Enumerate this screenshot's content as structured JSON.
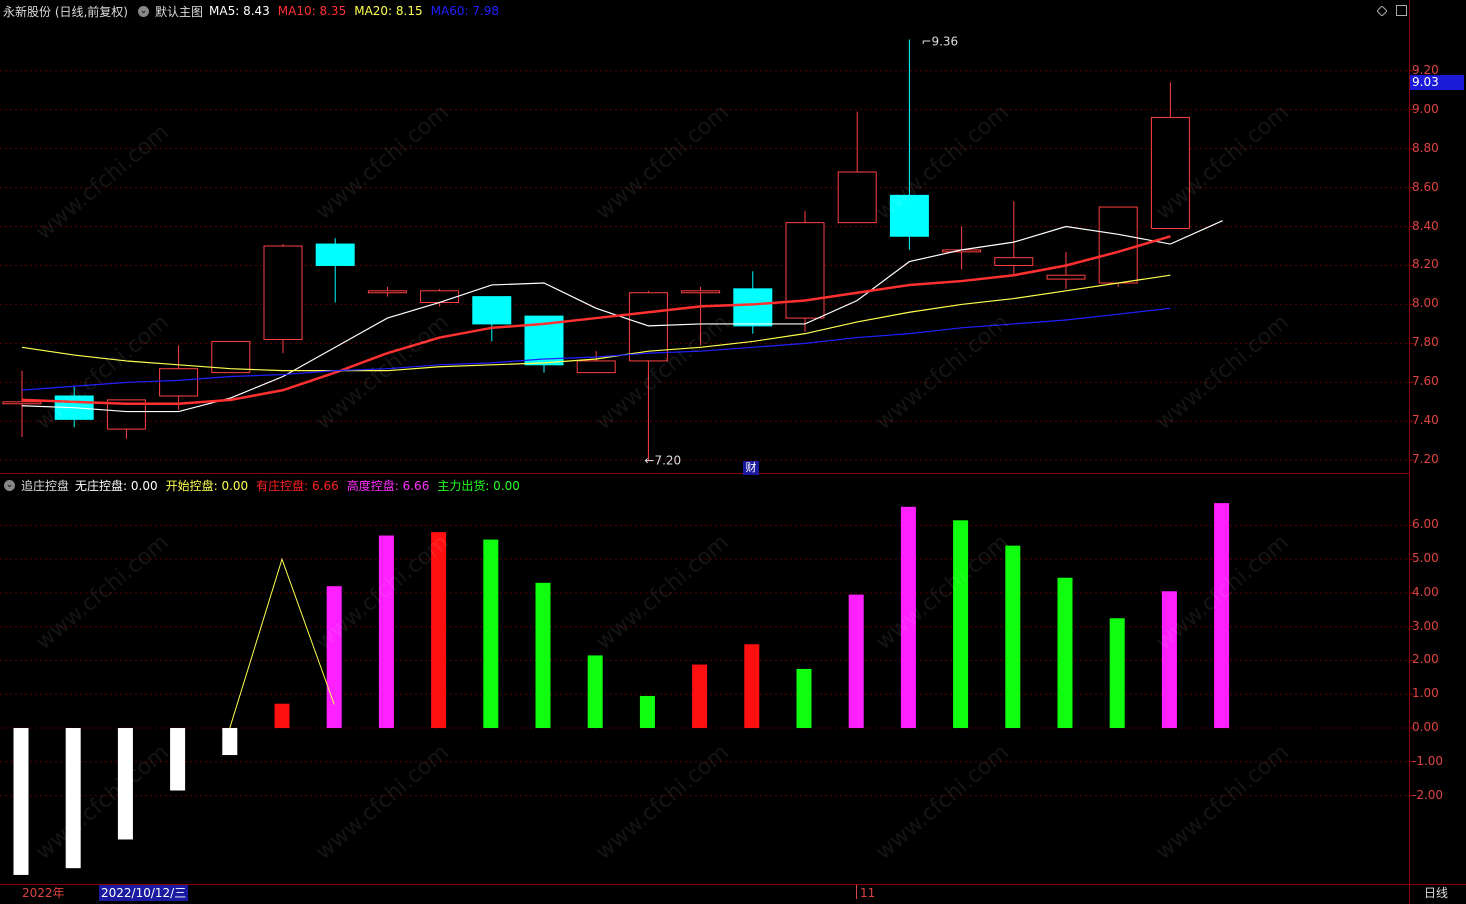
{
  "header": {
    "stock_title": "永新股份 (日线,前复权)",
    "template_label": "默认主图",
    "ma": [
      {
        "label": "MA5:",
        "value": "8.43",
        "color": "#ffffff"
      },
      {
        "label": "MA10:",
        "value": "8.35",
        "color": "#ff3030"
      },
      {
        "label": "MA20:",
        "value": "8.15",
        "color": "#ffff50"
      },
      {
        "label": "MA60:",
        "value": "7.98",
        "color": "#2020ff"
      }
    ]
  },
  "indicator_header": {
    "name": "追庄控盘",
    "items": [
      {
        "label": "无庄控盘:",
        "value": "0.00",
        "color": "#ffffff"
      },
      {
        "label": "开始控盘:",
        "value": "0.00",
        "color": "#ffff50"
      },
      {
        "label": "有庄控盘:",
        "value": "6.66",
        "color": "#ff2020"
      },
      {
        "label": "高度控盘:",
        "value": "6.66",
        "color": "#ff30ff"
      },
      {
        "label": "主力出货:",
        "value": "0.00",
        "color": "#20ff20"
      }
    ]
  },
  "price_axis": [
    "9.20",
    "9.00",
    "8.80",
    "8.60",
    "8.40",
    "8.20",
    "8.00",
    "7.80",
    "7.60",
    "7.40",
    "7.20"
  ],
  "ind_axis": [
    "6.00",
    "5.00",
    "4.00",
    "3.00",
    "2.00",
    "1.00",
    "0.00",
    "-1.00",
    "-2.00"
  ],
  "last_price": "9.03",
  "high_marker": "9.36",
  "low_marker": "7.20",
  "fin_tag": "财",
  "bottom": {
    "year": "2022年",
    "cursor_date": "2022/10/12/三",
    "month_tick": "11",
    "period": "日线"
  },
  "watermark": "www.cfchi.com",
  "chart_data": [
    {
      "type": "candlestick",
      "ylim": [
        7.15,
        9.45
      ],
      "candles": [
        {
          "o": 7.49,
          "h": 7.66,
          "l": 7.32,
          "c": 7.5
        },
        {
          "o": 7.53,
          "h": 7.58,
          "l": 7.37,
          "c": 7.41
        },
        {
          "o": 7.36,
          "h": 7.51,
          "l": 7.31,
          "c": 7.51
        },
        {
          "o": 7.53,
          "h": 7.79,
          "l": 7.46,
          "c": 7.67
        },
        {
          "o": 7.65,
          "h": 7.81,
          "l": 7.65,
          "c": 7.81
        },
        {
          "o": 7.82,
          "h": 8.31,
          "l": 7.75,
          "c": 8.3
        },
        {
          "o": 8.31,
          "h": 8.34,
          "l": 8.01,
          "c": 8.2
        },
        {
          "o": 8.06,
          "h": 8.09,
          "l": 8.04,
          "c": 8.07
        },
        {
          "o": 8.01,
          "h": 8.08,
          "l": 7.99,
          "c": 8.07
        },
        {
          "o": 8.04,
          "h": 8.04,
          "l": 7.81,
          "c": 7.9
        },
        {
          "o": 7.94,
          "h": 7.94,
          "l": 7.65,
          "c": 7.69
        },
        {
          "o": 7.65,
          "h": 7.76,
          "l": 7.65,
          "c": 7.71
        },
        {
          "o": 7.71,
          "h": 8.07,
          "l": 7.2,
          "c": 8.06
        },
        {
          "o": 8.06,
          "h": 8.09,
          "l": 7.79,
          "c": 8.07
        },
        {
          "o": 8.08,
          "h": 8.17,
          "l": 7.85,
          "c": 7.89
        },
        {
          "o": 7.93,
          "h": 8.48,
          "l": 7.86,
          "c": 8.42
        },
        {
          "o": 8.42,
          "h": 8.99,
          "l": 8.42,
          "c": 8.68
        },
        {
          "o": 8.56,
          "h": 9.36,
          "l": 8.28,
          "c": 8.35
        },
        {
          "o": 8.27,
          "h": 8.4,
          "l": 8.18,
          "c": 8.28
        },
        {
          "o": 8.2,
          "h": 8.53,
          "l": 8.15,
          "c": 8.24
        },
        {
          "o": 8.13,
          "h": 8.27,
          "l": 8.08,
          "c": 8.15
        },
        {
          "o": 8.11,
          "h": 8.5,
          "l": 8.09,
          "c": 8.5
        },
        {
          "o": 8.39,
          "h": 9.14,
          "l": 8.39,
          "c": 8.96
        }
      ],
      "ma_series": [
        {
          "name": "MA5",
          "color": "#ffffff",
          "values": [
            7.48,
            7.47,
            7.45,
            7.45,
            7.52,
            7.63,
            7.78,
            7.93,
            8.01,
            8.1,
            8.11,
            7.98,
            7.89,
            7.9,
            7.9,
            7.9,
            8.02,
            8.22,
            8.28,
            8.32,
            8.4,
            8.36,
            8.31,
            8.43
          ]
        },
        {
          "name": "MA10",
          "color": "#ff3030",
          "values": [
            7.51,
            7.5,
            7.49,
            7.49,
            7.51,
            7.56,
            7.65,
            7.75,
            7.83,
            7.88,
            7.9,
            7.93,
            7.96,
            7.99,
            8.0,
            8.02,
            8.06,
            8.1,
            8.12,
            8.15,
            8.2,
            8.27,
            8.35
          ]
        },
        {
          "name": "MA20",
          "color": "#ffff50",
          "values": [
            7.78,
            7.74,
            7.71,
            7.69,
            7.67,
            7.66,
            7.66,
            7.66,
            7.68,
            7.69,
            7.7,
            7.72,
            7.76,
            7.78,
            7.81,
            7.85,
            7.91,
            7.96,
            8.0,
            8.03,
            8.07,
            8.11,
            8.15
          ]
        },
        {
          "name": "MA60",
          "color": "#2020ff",
          "values": [
            7.56,
            7.58,
            7.6,
            7.61,
            7.63,
            7.64,
            7.66,
            7.67,
            7.69,
            7.7,
            7.72,
            7.73,
            7.75,
            7.76,
            7.78,
            7.8,
            7.83,
            7.85,
            7.88,
            7.9,
            7.92,
            7.95,
            7.98
          ]
        }
      ]
    },
    {
      "type": "bar",
      "ylim": [
        -4.5,
        6.9
      ],
      "values": [
        -4.35,
        -4.15,
        -3.3,
        -1.85,
        -0.8,
        0.72,
        4.2,
        5.7,
        5.8,
        5.58,
        4.3,
        2.15,
        0.95,
        1.88,
        2.48,
        1.75,
        3.95,
        6.55,
        6.15,
        5.4,
        4.45,
        3.25,
        4.05,
        6.66
      ],
      "colors": [
        "#ffffff",
        "#ffffff",
        "#ffffff",
        "#ffffff",
        "#ffffff",
        "#ff1010",
        "#ff20ff",
        "#ff20ff",
        "#ff1010",
        "#10ff10",
        "#10ff10",
        "#10ff10",
        "#10ff10",
        "#ff1010",
        "#ff1010",
        "#10ff10",
        "#ff20ff",
        "#ff20ff",
        "#10ff10",
        "#10ff10",
        "#10ff10",
        "#10ff10",
        "#ff20ff",
        "#ff20ff"
      ],
      "line": {
        "color": "#ffff50",
        "values": [
          null,
          null,
          null,
          null,
          0.0,
          5.0,
          0.7
        ]
      }
    }
  ]
}
